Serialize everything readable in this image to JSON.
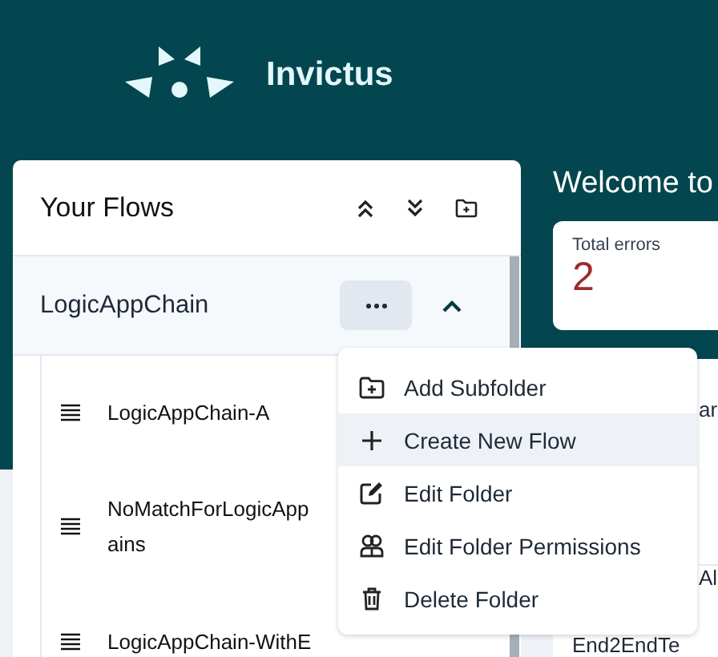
{
  "brand": {
    "name": "Invictus"
  },
  "flows_panel": {
    "title": "Your Flows",
    "folder": {
      "name": "LogicAppChain",
      "expanded": true
    },
    "items": [
      {
        "lines": [
          "LogicAppChain-A"
        ]
      },
      {
        "lines": [
          "NoMatchForLogicApp",
          "ains"
        ]
      },
      {
        "lines": [
          "LogicAppChain-WithE"
        ],
        "more": true
      }
    ]
  },
  "folder_menu": [
    {
      "kind": "add-folder",
      "label": "Add Subfolder",
      "highlighted": false
    },
    {
      "kind": "plus",
      "label": "Create New Flow",
      "highlighted": true
    },
    {
      "kind": "edit",
      "label": "Edit Folder",
      "highlighted": false
    },
    {
      "kind": "people",
      "label": "Edit Folder Permissions",
      "highlighted": false
    },
    {
      "kind": "trash",
      "label": "Delete Folder",
      "highlighted": false
    }
  ],
  "dashboard": {
    "title": "Welcome to",
    "stats": [
      {
        "label": "Total errors",
        "value": "2"
      }
    ],
    "table_fragments": [
      "ar",
      "Al",
      "End2EndTe"
    ]
  }
}
